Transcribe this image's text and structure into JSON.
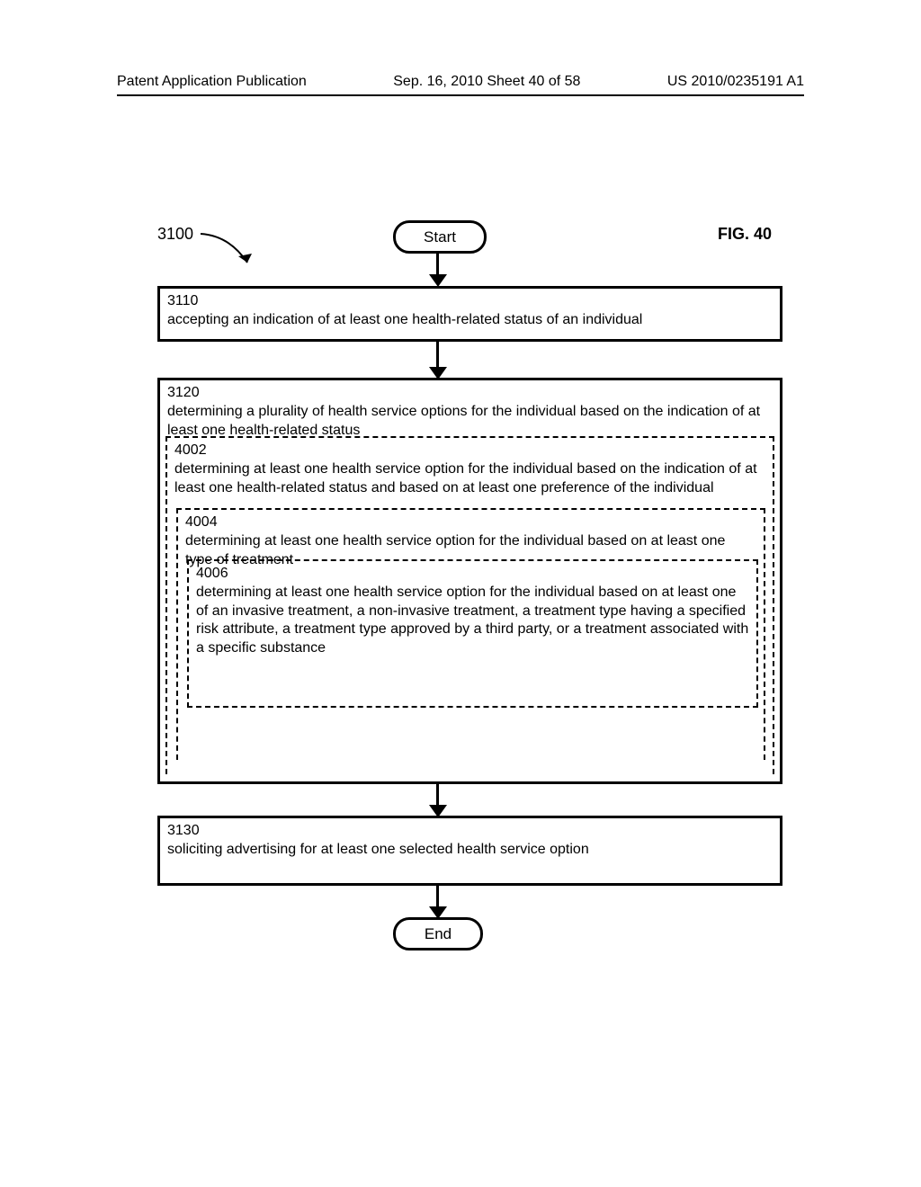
{
  "header": {
    "left": "Patent Application Publication",
    "center": "Sep. 16, 2010  Sheet 40 of 58",
    "right": "US 2010/0235191 A1"
  },
  "reference_number": "3100",
  "fig_label": "FIG. 40",
  "start_label": "Start",
  "end_label": "End",
  "box_3110": {
    "number": "3110",
    "text": "accepting an indication of at least one health-related status of an individual"
  },
  "box_3120": {
    "number": "3120",
    "text": "determining a plurality of health service options for the individual based on the indication of at least one health-related status"
  },
  "box_3130": {
    "number": "3130",
    "text": "soliciting advertising for at least one selected health service option"
  },
  "box_4002": {
    "number": "4002",
    "text": "determining at least one health service option for the individual based on the indication of at least one health-related status and based on at least one preference of the individual"
  },
  "box_4004": {
    "number": "4004",
    "text": "determining at least one health service option for the individual based on at least one type of treatment"
  },
  "box_4006": {
    "number": "4006",
    "text": "determining at least one health service option for the individual based on at least one of an invasive treatment, a non-invasive treatment, a treatment type having a specified risk attribute, a treatment type approved by a third party, or a treatment associated with a specific substance"
  }
}
